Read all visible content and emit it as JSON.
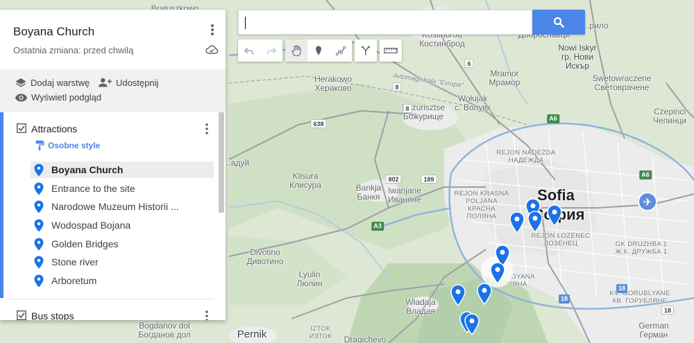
{
  "panel": {
    "title": "Boyana Church",
    "subtitle": "Ostatnia zmiana: przed chwilą",
    "actions": {
      "add_layer": "Dodaj warstwę",
      "share": "Udostępnij",
      "preview": "Wyświetl podgląd"
    },
    "layers": [
      {
        "name": "Attractions",
        "checked": true,
        "style_link": "Osobne style",
        "items": [
          {
            "label": "Boyana Church",
            "selected": true
          },
          {
            "label": "Entrance to the site",
            "selected": false
          },
          {
            "label": "Narodowe Muzeum Historii ...",
            "selected": false
          },
          {
            "label": "Wodospad Bojana",
            "selected": false
          },
          {
            "label": "Golden Bridges",
            "selected": false
          },
          {
            "label": "Stone river",
            "selected": false
          },
          {
            "label": "Arboretum",
            "selected": false
          }
        ]
      },
      {
        "name": "Bus stops",
        "checked": true
      }
    ]
  },
  "search": {
    "value": "",
    "placeholder": ""
  },
  "toolbar": {
    "tools": [
      "undo-icon",
      "redo-icon",
      "hand-icon",
      "marker-icon",
      "draw-line-icon",
      "directions-icon",
      "ruler-icon"
    ]
  },
  "map": {
    "labels": {
      "bratuszkowo": "Bratuszkowo",
      "kostinbrod": "Kostinbrod\nКостинброд",
      "dobroslavtsi": "Доброславци",
      "ilientsi": "...рило",
      "nowi_iskyr": "Nowi Iskyr\nгр. Нови\nИскър",
      "herakowo": "Herakowo\nХераково",
      "mramor": "Mramor\nМрамор",
      "wolujak": "Wołujak\nс. Волуяк",
      "swetowraczene": "Swetowraczene\nСветовраченe",
      "bozurisztse": "Bożurisztse\nБожурище",
      "czepinci": "Czepinci\nЧепинци",
      "autostrada": "Avtomagistrala \"Evropa\"",
      "rejon_nadezda": "REJON NADEŻDA\nНАДЕЖДА",
      "nadezhda_left": "...адуй",
      "klisura": "Klisura\nКлисура",
      "bankja": "Bankja\nБанкя",
      "iwanjane": "Iwanjane\nИваняне",
      "rejon_krasna": "REJON KRASNA\nPOLJANA\nКРАСНА\nПОЛЯНА",
      "sofia": "Sofia",
      "sofia_cyr": "София",
      "rejon_lozenec": "REJON ŁOZENEC\nЛОЗЕНЕЦ",
      "druzhba": "GK DRUZHBA 1\nЖ.К. ДРУЖБА 1",
      "divotino": "Divotino\nДивотино",
      "lyulin": "Lyulin\nЛюлин",
      "boyana_district": "...OYANA\nЯНА",
      "wladaja": "Władaja\nВладая",
      "gorubljane": "KV. GORUBLYANE\nКВ. ГОРУБЛЯНЕ",
      "bogdanov_dol": "Bogdanov dol\nБогданов дол",
      "pernik": "Pernik",
      "iztok": "IZTOK\nИЗТОК",
      "dragichevo": "Dragichevo",
      "german": "German\nГерман"
    },
    "shields": [
      "8",
      "8",
      "6",
      "A6",
      "638",
      "802",
      "189",
      "A3",
      "A6",
      "18",
      "18",
      "18"
    ]
  },
  "colors": {
    "accent": "#4a86e8",
    "pin": "#1a73e8",
    "panel_bg": "#ffffff",
    "actions_bg": "#f1f1f1"
  }
}
